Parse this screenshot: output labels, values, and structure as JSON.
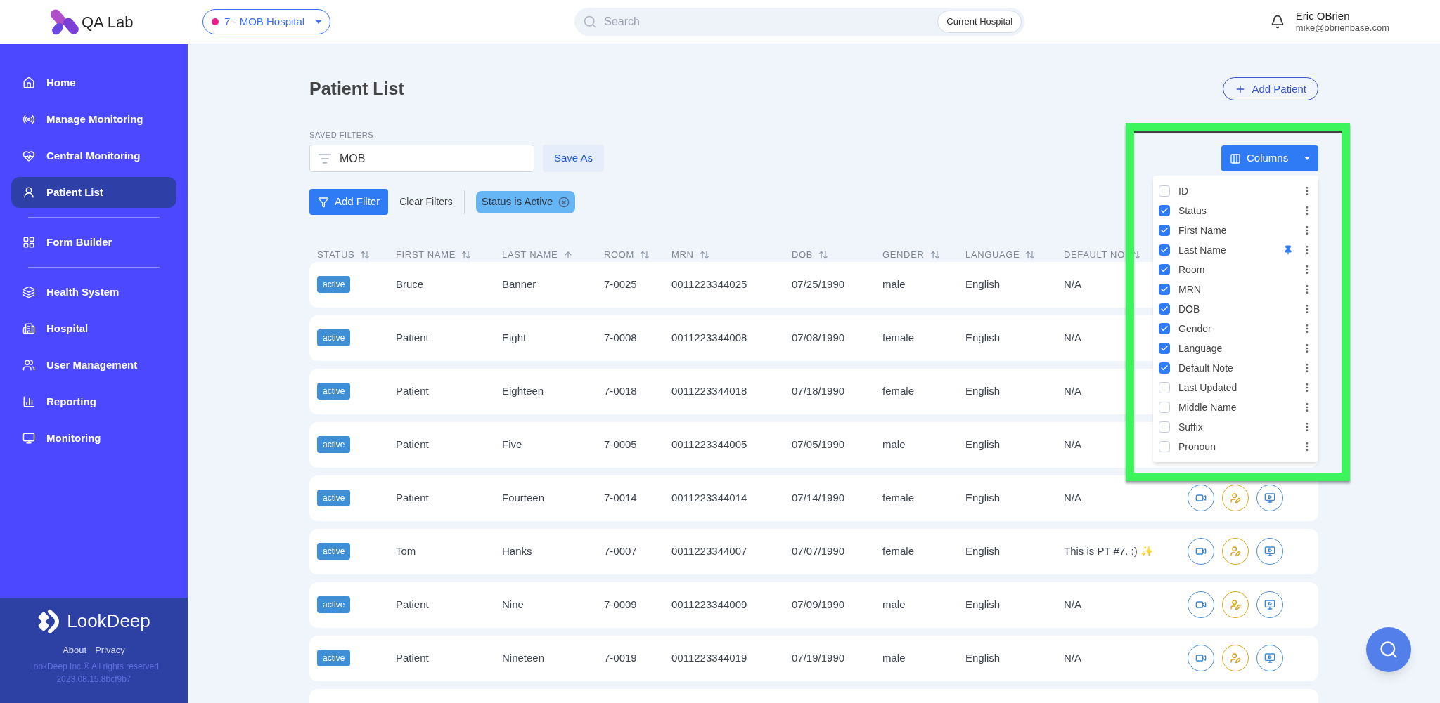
{
  "app": {
    "title": "QA Lab"
  },
  "hospital_selector": {
    "label": "7 - MOB Hospital",
    "color": "#e91e8c"
  },
  "search": {
    "placeholder": "Search",
    "scope_button": "Current Hospital"
  },
  "user": {
    "name": "Eric OBrien",
    "email": "mike@obrienbase.com"
  },
  "sidebar": {
    "sections": [
      {
        "items": [
          {
            "kind": "home",
            "label": "Home",
            "selected": false
          },
          {
            "kind": "signal",
            "label": "Manage Monitoring",
            "selected": false
          },
          {
            "kind": "heart",
            "label": "Central Monitoring",
            "selected": false
          },
          {
            "kind": "patient",
            "label": "Patient List",
            "selected": true
          }
        ]
      },
      {
        "items": [
          {
            "kind": "form",
            "label": "Form Builder",
            "selected": false
          }
        ]
      },
      {
        "items": [
          {
            "kind": "layers",
            "label": "Health System",
            "selected": false
          },
          {
            "kind": "building",
            "label": "Hospital",
            "selected": false
          },
          {
            "kind": "users",
            "label": "User Management",
            "selected": false
          },
          {
            "kind": "chart",
            "label": "Reporting",
            "selected": false
          },
          {
            "kind": "monitor",
            "label": "Monitoring",
            "selected": false
          }
        ]
      }
    ],
    "footer": {
      "brand": "LookDeep",
      "links": [
        "About",
        "Privacy"
      ],
      "copyright": "LookDeep Inc.® All rights reserved",
      "version": "2023.08.15.8bcf9b7"
    }
  },
  "page": {
    "title": "Patient List",
    "add_button": "Add Patient"
  },
  "saved_filters": {
    "label": "SAVED FILTERS",
    "value": "MOB",
    "save_button": "Save As"
  },
  "filters": {
    "add_button": "Add Filter",
    "clear_link": "Clear Filters",
    "chips": [
      "Status is Active"
    ]
  },
  "table": {
    "columns": [
      {
        "label": "STATUS",
        "sorted": false
      },
      {
        "label": "FIRST NAME",
        "sorted": false
      },
      {
        "label": "LAST NAME",
        "sorted": true
      },
      {
        "label": "ROOM",
        "sorted": false
      },
      {
        "label": "MRN",
        "sorted": false
      },
      {
        "label": "DOB",
        "sorted": false
      },
      {
        "label": "GENDER",
        "sorted": false
      },
      {
        "label": "LANGUAGE",
        "sorted": false
      },
      {
        "label": "DEFAULT NO",
        "sorted": false
      }
    ],
    "rows": [
      {
        "status": "active",
        "first": "Bruce",
        "last": "Banner",
        "room": "7-0025",
        "mrn": "0011223344025",
        "dob": "07/25/1990",
        "gender": "male",
        "language": "English",
        "note": "N/A"
      },
      {
        "status": "active",
        "first": "Patient",
        "last": "Eight",
        "room": "7-0008",
        "mrn": "0011223344008",
        "dob": "07/08/1990",
        "gender": "female",
        "language": "English",
        "note": "N/A"
      },
      {
        "status": "active",
        "first": "Patient",
        "last": "Eighteen",
        "room": "7-0018",
        "mrn": "0011223344018",
        "dob": "07/18/1990",
        "gender": "female",
        "language": "English",
        "note": "N/A"
      },
      {
        "status": "active",
        "first": "Patient",
        "last": "Five",
        "room": "7-0005",
        "mrn": "0011223344005",
        "dob": "07/05/1990",
        "gender": "male",
        "language": "English",
        "note": "N/A"
      },
      {
        "status": "active",
        "first": "Patient",
        "last": "Fourteen",
        "room": "7-0014",
        "mrn": "0011223344014",
        "dob": "07/14/1990",
        "gender": "female",
        "language": "English",
        "note": "N/A",
        "actions": [
          {
            "kind": "video"
          },
          {
            "kind": "edit"
          },
          {
            "kind": "monitor"
          }
        ]
      },
      {
        "status": "active",
        "first": "Tom",
        "last": "Hanks",
        "room": "7-0007",
        "mrn": "0011223344007",
        "dob": "07/07/1990",
        "gender": "female",
        "language": "English",
        "note": "This is PT #7. :) ✨",
        "actions": [
          {
            "kind": "video"
          },
          {
            "kind": "edit"
          },
          {
            "kind": "monitor"
          }
        ]
      },
      {
        "status": "active",
        "first": "Patient",
        "last": "Nine",
        "room": "7-0009",
        "mrn": "0011223344009",
        "dob": "07/09/1990",
        "gender": "male",
        "language": "English",
        "note": "N/A",
        "actions": [
          {
            "kind": "video"
          },
          {
            "kind": "edit"
          },
          {
            "kind": "monitor"
          }
        ]
      },
      {
        "status": "active",
        "first": "Patient",
        "last": "Nineteen",
        "room": "7-0019",
        "mrn": "0011223344019",
        "dob": "07/19/1990",
        "gender": "male",
        "language": "English",
        "note": "N/A",
        "actions": [
          {
            "kind": "video"
          },
          {
            "kind": "edit"
          },
          {
            "kind": "monitor"
          }
        ]
      }
    ]
  },
  "columns_menu": {
    "button": "Columns",
    "highlighted": true,
    "items": [
      {
        "label": "ID",
        "checked": false,
        "pinned": false
      },
      {
        "label": "Status",
        "checked": true,
        "pinned": false
      },
      {
        "label": "First Name",
        "checked": true,
        "pinned": false
      },
      {
        "label": "Last Name",
        "checked": true,
        "pinned": true
      },
      {
        "label": "Room",
        "checked": true,
        "pinned": false
      },
      {
        "label": "MRN",
        "checked": true,
        "pinned": false
      },
      {
        "label": "DOB",
        "checked": true,
        "pinned": false
      },
      {
        "label": "Gender",
        "checked": true,
        "pinned": false
      },
      {
        "label": "Language",
        "checked": true,
        "pinned": false
      },
      {
        "label": "Default Note",
        "checked": true,
        "pinned": false
      },
      {
        "label": "Last Updated",
        "checked": false,
        "pinned": false
      },
      {
        "label": "Middle Name",
        "checked": false,
        "pinned": false
      },
      {
        "label": "Suffix",
        "checked": false,
        "pinned": false
      },
      {
        "label": "Pronoun",
        "checked": false,
        "pinned": false
      }
    ]
  }
}
